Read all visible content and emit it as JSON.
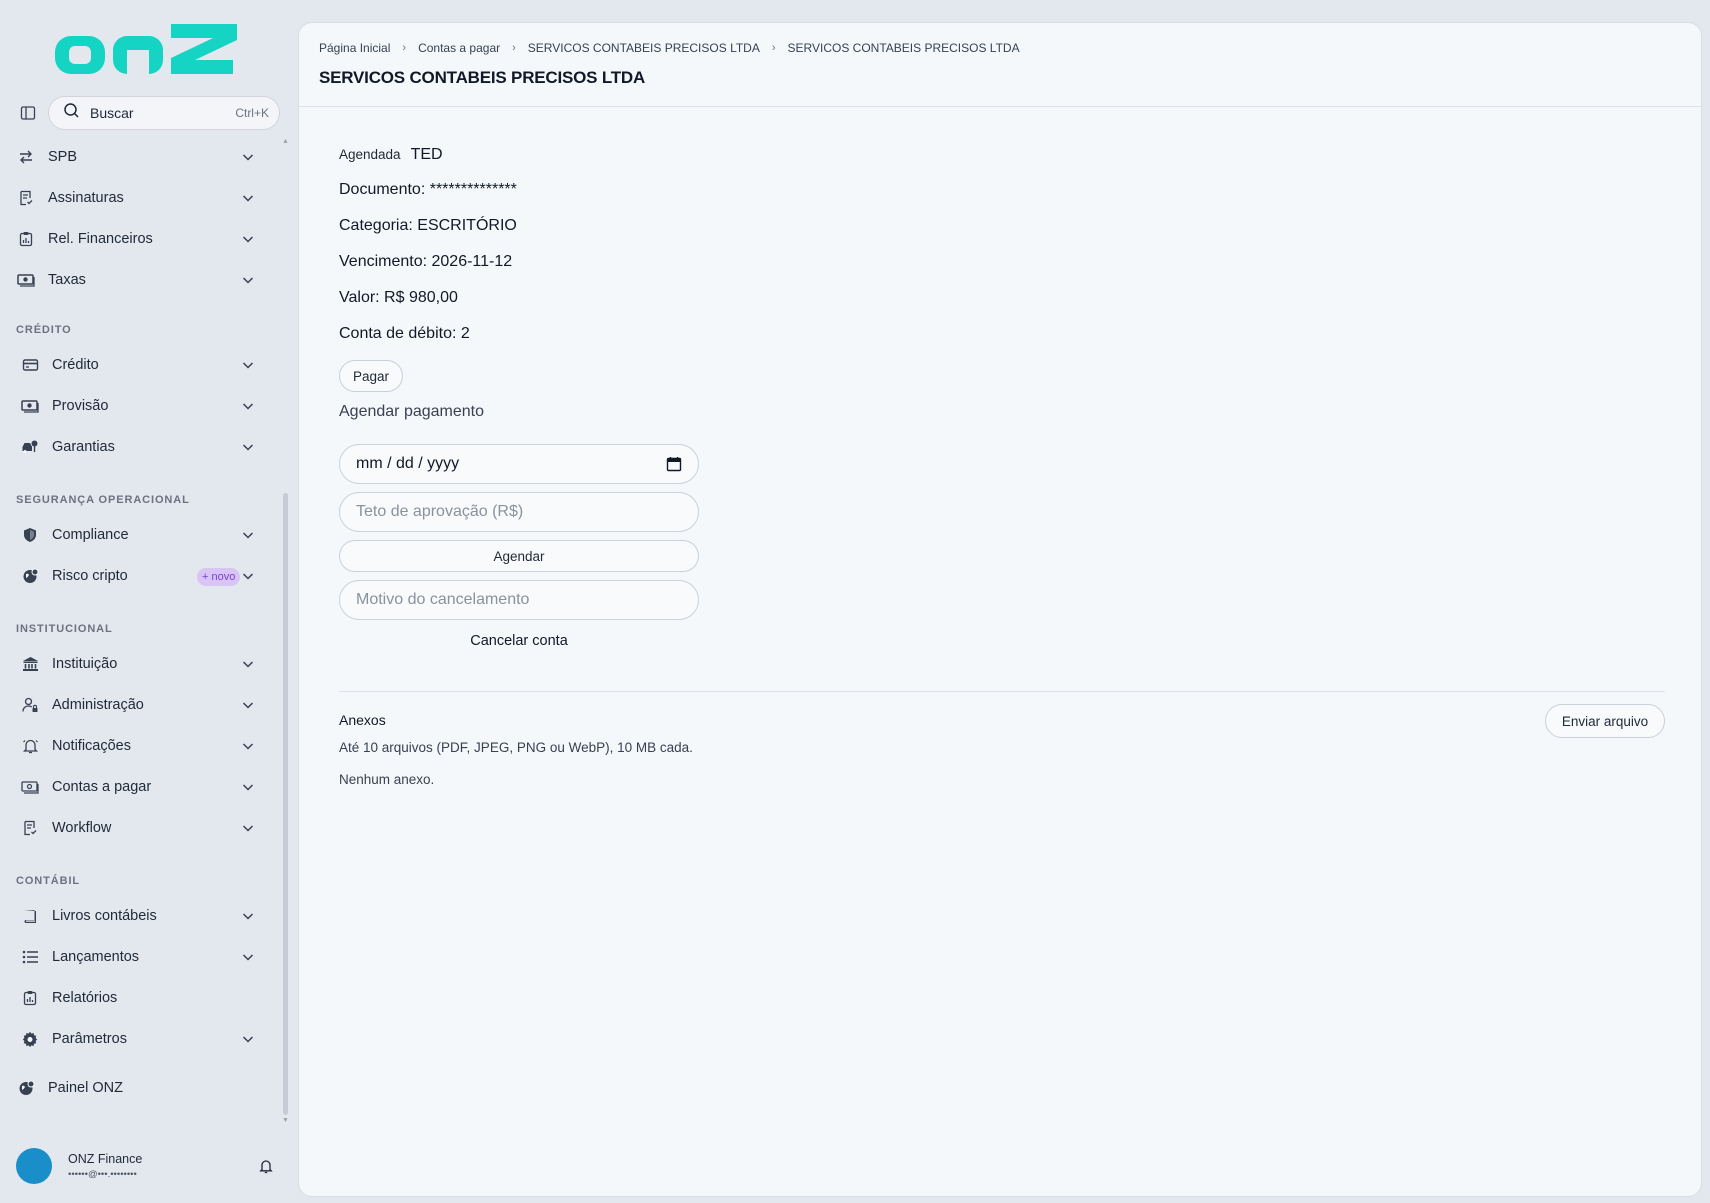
{
  "brand": {
    "logo_text": "onz",
    "accent": "#15d4c4"
  },
  "search": {
    "label": "Buscar",
    "shortcut": "Ctrl+K"
  },
  "sidebar": {
    "items_top": [
      {
        "label": "SPB",
        "icon": "transfer-arrows-icon"
      },
      {
        "label": "Assinaturas",
        "icon": "document-check-icon"
      },
      {
        "label": "Rel. Financeiros",
        "icon": "clipboard-chart-icon"
      },
      {
        "label": "Taxas",
        "icon": "banknote-icon"
      }
    ],
    "sections": [
      {
        "title": "CRÉDITO",
        "items": [
          {
            "label": "Crédito",
            "icon": "credit-card-icon"
          },
          {
            "label": "Provisão",
            "icon": "banknote-icon"
          },
          {
            "label": "Garantias",
            "icon": "car-key-icon"
          }
        ]
      },
      {
        "title": "SEGURANÇA OPERACIONAL",
        "items": [
          {
            "label": "Compliance",
            "icon": "shield-icon"
          },
          {
            "label": "Risco cripto",
            "icon": "globe-icon",
            "badge": "+ novo"
          }
        ]
      },
      {
        "title": "INSTITUCIONAL",
        "items": [
          {
            "label": "Instituição",
            "icon": "bank-icon"
          },
          {
            "label": "Administração",
            "icon": "user-lock-icon"
          },
          {
            "label": "Notificações",
            "icon": "bell-icon"
          },
          {
            "label": "Contas a pagar",
            "icon": "cash-icon"
          },
          {
            "label": "Workflow",
            "icon": "document-check-icon"
          }
        ]
      },
      {
        "title": "CONTÁBIL",
        "items": [
          {
            "label": "Livros contábeis",
            "icon": "book-icon"
          },
          {
            "label": "Lançamentos",
            "icon": "list-icon"
          },
          {
            "label": "Relatórios",
            "icon": "clipboard-icon",
            "no_chevron": true
          },
          {
            "label": "Parâmetros",
            "icon": "gear-icon"
          }
        ]
      }
    ],
    "footer_item": {
      "label": "Painel ONZ",
      "icon": "globe-icon"
    }
  },
  "user": {
    "name": "ONZ Finance",
    "email": "••••••@•••.••••••••"
  },
  "breadcrumb": [
    "Página Inicial",
    "Contas a pagar",
    "SERVICOS CONTABEIS PRECISOS LTDA",
    "SERVICOS CONTABEIS PRECISOS LTDA"
  ],
  "page": {
    "title": "SERVICOS CONTABEIS PRECISOS LTDA",
    "status_label": "Agendada",
    "status_value": "TED",
    "document": "Documento: **************",
    "category": "Categoria: ESCRITÓRIO",
    "due": "Vencimento: 2026-11-12",
    "amount": "Valor: R$ 980,00",
    "debit_account": "Conta de débito: 2",
    "pay_button": "Pagar",
    "schedule_heading": "Agendar pagamento",
    "date_input": "mm / dd / yyyy",
    "ceiling_placeholder": "Teto de aprovação (R$)",
    "schedule_button": "Agendar",
    "cancel_reason_placeholder": "Motivo do cancelamento",
    "cancel_button": "Cancelar conta"
  },
  "attachments": {
    "title": "Anexos",
    "hint": "Até 10 arquivos (PDF, JPEG, PNG ou WebP), 10 MB cada.",
    "empty": "Nenhum anexo.",
    "upload_button": "Enviar arquivo"
  }
}
